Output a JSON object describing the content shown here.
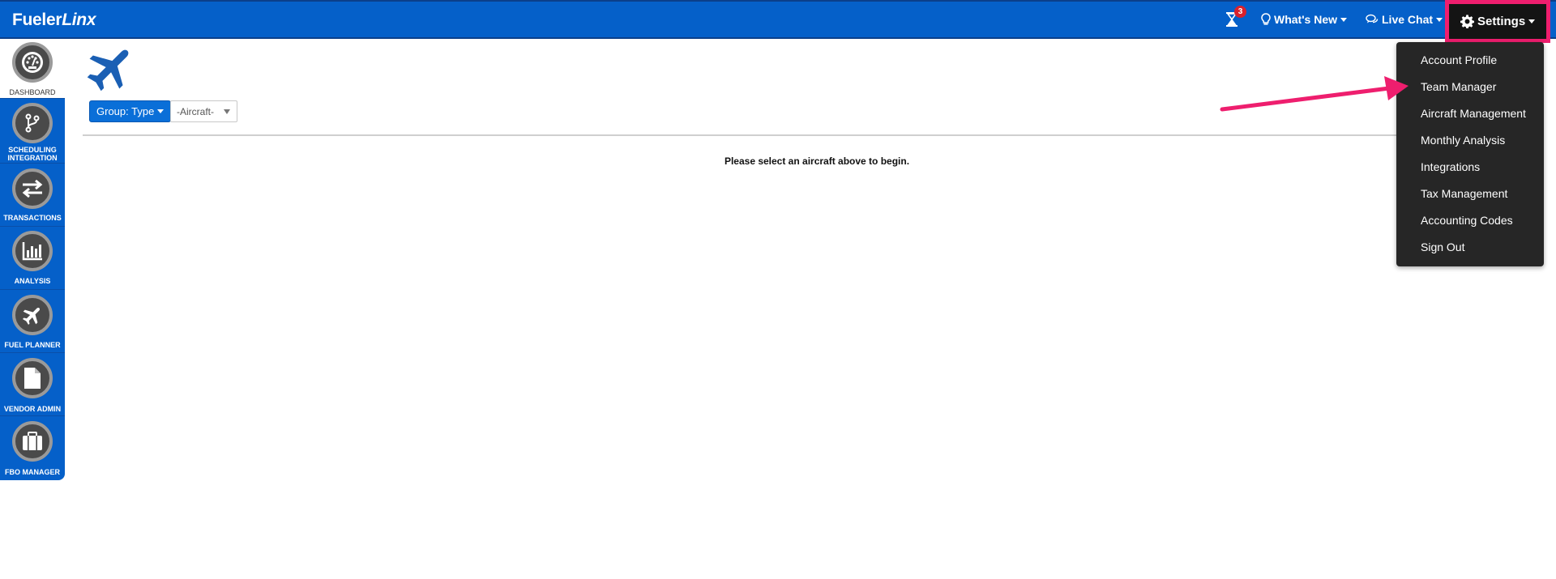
{
  "brand": {
    "part1": "Fueler",
    "part2": "Linx"
  },
  "topnav": {
    "notification_count": "3",
    "whats_new": "What's New",
    "live_chat": "Live Chat",
    "settings": "Settings"
  },
  "sidebar": {
    "items": [
      {
        "label": "DASHBOARD",
        "icon": "dashboard-icon"
      },
      {
        "label": "SCHEDULING INTEGRATION",
        "icon": "branch-icon"
      },
      {
        "label": "TRANSACTIONS",
        "icon": "transfer-icon"
      },
      {
        "label": "ANALYSIS",
        "icon": "bar-chart-icon"
      },
      {
        "label": "FUEL PLANNER",
        "icon": "plane-icon"
      },
      {
        "label": "VENDOR ADMIN",
        "icon": "file-icon"
      },
      {
        "label": "FBO MANAGER",
        "icon": "briefcase-icon"
      }
    ]
  },
  "main": {
    "group_button": "Group: Type",
    "aircraft_select": "-Aircraft-",
    "prompt": "Please select an aircraft above to begin."
  },
  "settings_menu": {
    "items": [
      "Account Profile",
      "Team Manager",
      "Aircraft Management",
      "Monthly Analysis",
      "Integrations",
      "Tax Management",
      "Accounting Codes",
      "Sign Out"
    ]
  },
  "colors": {
    "primary": "#0560c9",
    "highlight": "#ee1e6e",
    "menu_bg": "#262626",
    "badge": "#d9212c"
  }
}
